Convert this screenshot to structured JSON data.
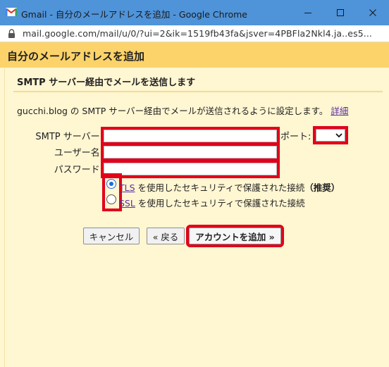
{
  "window": {
    "title": "Gmail - 自分のメールアドレスを追加 - Google Chrome",
    "url": "mail.google.com/mail/u/0/?ui=2&ik=1519fb43fa&jsver=4PBFla2Nkl4.ja..es5...",
    "controls": [
      "minimize-icon",
      "maximize-icon",
      "close-icon"
    ]
  },
  "dialog": {
    "title": "自分のメールアドレスを追加",
    "section_title": "SMTP サーバー経由でメールを送信します",
    "description": "gucchi.blog の SMTP サーバー経由でメールが送信されるように設定します。",
    "details_link": "詳細"
  },
  "form": {
    "smtp_label": "SMTP サーバー:",
    "smtp_value": "",
    "port_label": "ポート:",
    "port_value": "",
    "username_label": "ユーザー名:",
    "username_value": "",
    "password_label": "パスワード:",
    "password_value": "",
    "tls": {
      "link": "TLS",
      "text": " を使用したセキュリティで保護された接続",
      "note": "（推奨）",
      "checked": true
    },
    "ssl": {
      "link": "SSL",
      "text": " を使用したセキュリティで保護された接続",
      "checked": false
    }
  },
  "buttons": {
    "cancel": "キャンセル",
    "back": "« 戻る",
    "add": "アカウントを追加 »"
  },
  "colors": {
    "titlebar": "#4f93d9",
    "dialog_header": "#fcd36a",
    "dialog_body": "#fff6d2",
    "highlight": "#e2001a",
    "link": "#5a2fa0"
  }
}
